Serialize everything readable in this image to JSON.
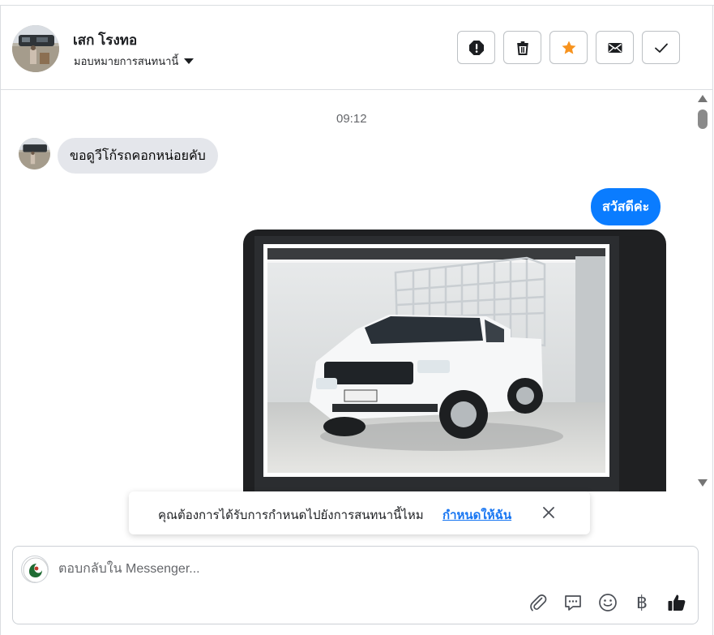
{
  "header": {
    "contact_name": "เสก โรงทอ",
    "assign_label": "มอบหมายการสนทนานี้",
    "actions": [
      "alert-icon",
      "trash-icon",
      "star-icon",
      "envelope-icon",
      "check-icon"
    ]
  },
  "conversation": {
    "timestamp": "09:12",
    "incoming": "ขอดูวีโก้รถคอกหน่อยคับ",
    "outgoing": "สวัสดีค่ะ"
  },
  "toast": {
    "message": "คุณต้องการได้รับการกำหนดไปยังการสนทนานี้ไหม",
    "action": "กำหนดให้ฉัน"
  },
  "composer": {
    "placeholder": "ตอบกลับใน Messenger...",
    "tools": [
      "paperclip-icon",
      "chat-bubble-icon",
      "smiley-icon",
      "baht-icon",
      "thumbs-up-icon"
    ],
    "baht_symbol": "฿"
  },
  "colors": {
    "brand_blue": "#0a7cff",
    "star_orange": "#f7931e",
    "link_blue": "#1876f2",
    "bubble_gray": "#e4e6eb"
  }
}
